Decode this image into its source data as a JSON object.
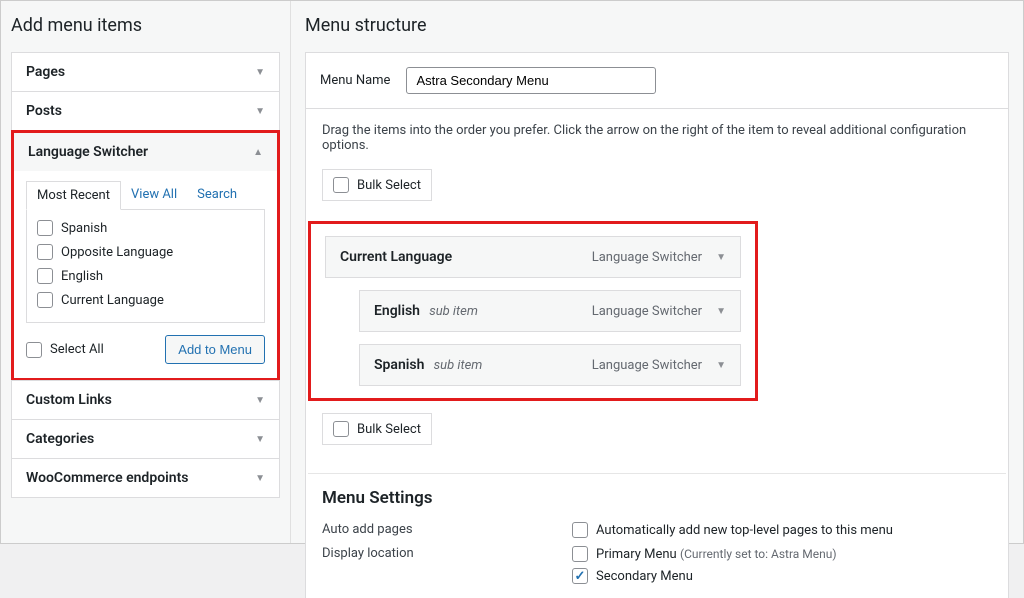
{
  "left": {
    "heading": "Add menu items",
    "accordions": {
      "pages": {
        "label": "Pages"
      },
      "posts": {
        "label": "Posts"
      },
      "language_switcher": {
        "label": "Language Switcher",
        "tabs": {
          "most_recent": "Most Recent",
          "view_all": "View All",
          "search": "Search"
        },
        "options": {
          "spanish": "Spanish",
          "opposite": "Opposite Language",
          "english": "English",
          "current": "Current Language"
        },
        "select_all": "Select All",
        "add_button": "Add to Menu"
      },
      "custom_links": {
        "label": "Custom Links"
      },
      "categories": {
        "label": "Categories"
      },
      "woocommerce": {
        "label": "WooCommerce endpoints"
      }
    }
  },
  "right": {
    "heading": "Menu structure",
    "menu_name_label": "Menu Name",
    "menu_name_value": "Astra Secondary Menu",
    "instructions": "Drag the items into the order you prefer. Click the arrow on the right of the item to reveal additional configuration options.",
    "bulk_select": "Bulk Select",
    "items": {
      "current": {
        "title": "Current Language",
        "type": "Language Switcher"
      },
      "english": {
        "title": "English",
        "sub": "sub item",
        "type": "Language Switcher"
      },
      "spanish": {
        "title": "Spanish",
        "sub": "sub item",
        "type": "Language Switcher"
      }
    },
    "settings": {
      "heading": "Menu Settings",
      "auto_add": {
        "label": "Auto add pages",
        "option": "Automatically add new top-level pages to this menu"
      },
      "display_location": {
        "label": "Display location",
        "primary": "Primary Menu",
        "primary_note": "(Currently set to: Astra Menu)",
        "secondary": "Secondary Menu"
      }
    }
  }
}
